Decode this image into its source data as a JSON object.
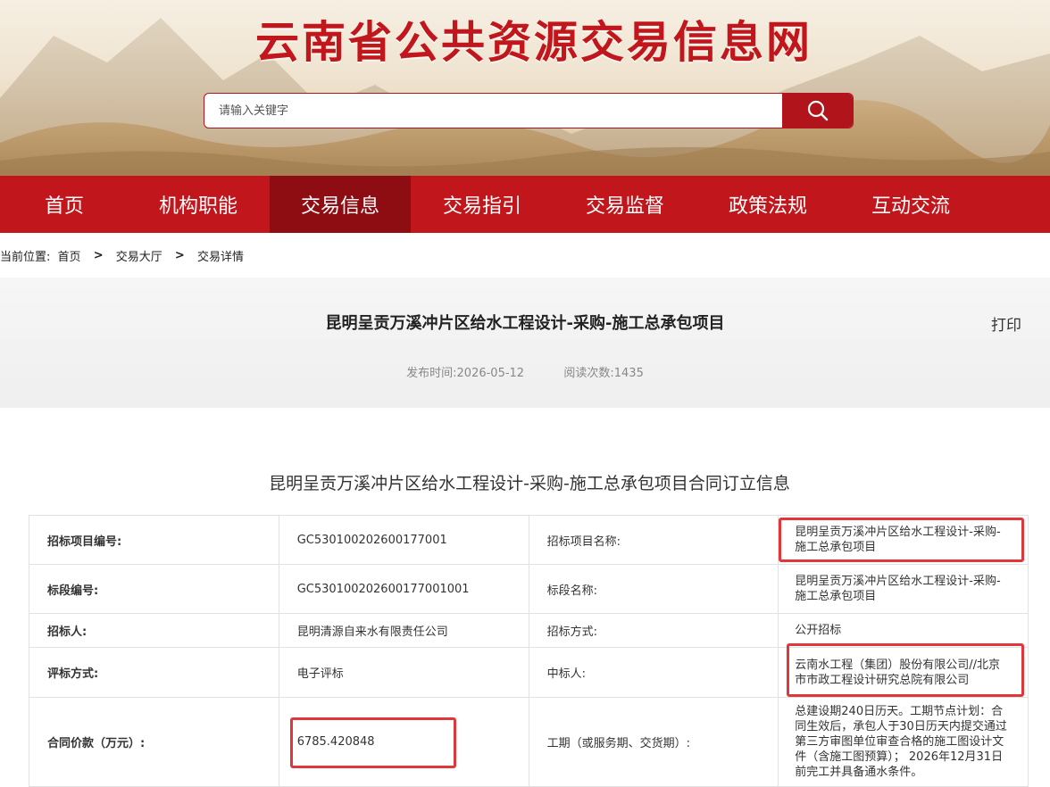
{
  "header": {
    "site_title": "云南省公共资源交易信息网",
    "search_placeholder": "请输入关键字",
    "search_icon": "search-icon"
  },
  "nav": {
    "items": [
      "首页",
      "机构职能",
      "交易信息",
      "交易指引",
      "交易监督",
      "政策法规",
      "互动交流"
    ],
    "active": "交易信息"
  },
  "breadcrumb": {
    "prefix": "当前位置:",
    "items": [
      "首页",
      "交易大厅",
      "交易详情"
    ],
    "separator": ">"
  },
  "article": {
    "title": "昆明呈贡万溪冲片区给水工程设计-采购-施工总承包项目",
    "print_label": "打印",
    "publish_label": "发布时间:",
    "publish_date": "2026-05-12",
    "views_label": "阅读次数:",
    "views": "1435"
  },
  "section_title": "昆明呈贡万溪冲片区给水工程设计-采购-施工总承包项目合同订立信息",
  "table": {
    "rows": [
      {
        "l1": "招标项目编号:",
        "v1": "GC5301002026001770​01",
        "l2": "招标项目名称:",
        "v2": "昆明呈贡万溪冲片区给水工程设计-采购-施工总承包项目"
      },
      {
        "l1": "标段编号:",
        "v1": "GC5301002026001770​01001",
        "l2": "标段名称:",
        "v2": "昆明呈贡万溪冲片区给水工程设计-采购-施工总承包项目"
      },
      {
        "l1": "招标人:",
        "v1": "昆明清源自来水有限责任公司",
        "l2": "招标方式:",
        "v2": "公开招标"
      },
      {
        "l1": "评标方式:",
        "v1": "电子评标",
        "l2": "中标人:",
        "v2": "云南水工程（集团）股份有限公司//北京市市政工程设计研究总院有限公司"
      },
      {
        "l1": "合同价款（万元）:",
        "v1": "6785.420848",
        "l2": "工期（或服务期、交货期）:",
        "v2": "总建设期240日历天。工期节点计划：合同生效后，承包人于30日历天内提交通过第三方审图单位审查合格的施工图设计文件（含施工图预算）； 2026年12月31日前完工并具备通水条件。"
      }
    ]
  },
  "colors": {
    "brand_red": "#c0161c",
    "nav_active": "#8e0d12",
    "highlight_border": "#e0373a"
  }
}
